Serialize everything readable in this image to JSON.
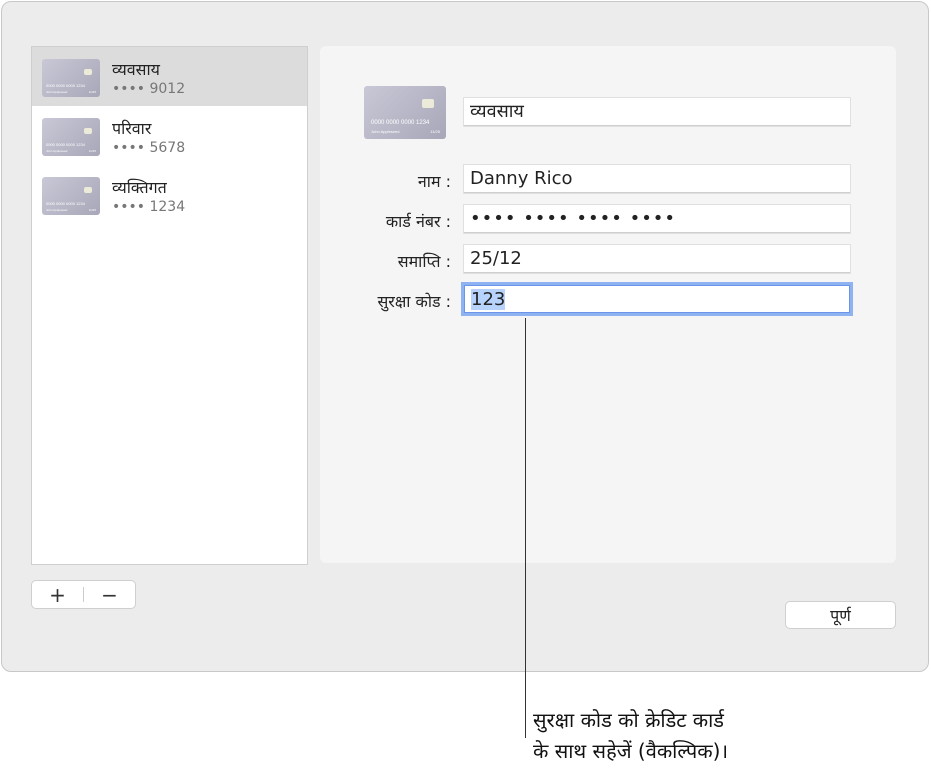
{
  "cards": [
    {
      "title": "व्यवसाय",
      "number": "•••• 9012",
      "selected": true
    },
    {
      "title": "परिवार",
      "number": "•••• 5678",
      "selected": false
    },
    {
      "title": "व्यक्तिगत",
      "number": "•••• 1234",
      "selected": false
    }
  ],
  "card_art": {
    "number": "0000 0000 0000 1234",
    "name": "John Appleseed",
    "expiry": "11/25"
  },
  "buttons": {
    "add": "+",
    "remove": "−",
    "done": "पूर्ण"
  },
  "detail": {
    "description": "व्यवसाय",
    "name_label": "नाम :",
    "name_value": "Danny Rico",
    "number_label": "कार्ड नंबर :",
    "number_value": "•••• •••• •••• ••••",
    "expiry_label": "समाप्ति :",
    "expiry_value": "25/12",
    "code_label": "सुरक्षा कोड :",
    "code_value": "123"
  },
  "callout": {
    "line1": "सुरक्षा कोड को क्रेडिट कार्ड",
    "line2": "के साथ सहेजें (वैकल्पिक)।"
  }
}
